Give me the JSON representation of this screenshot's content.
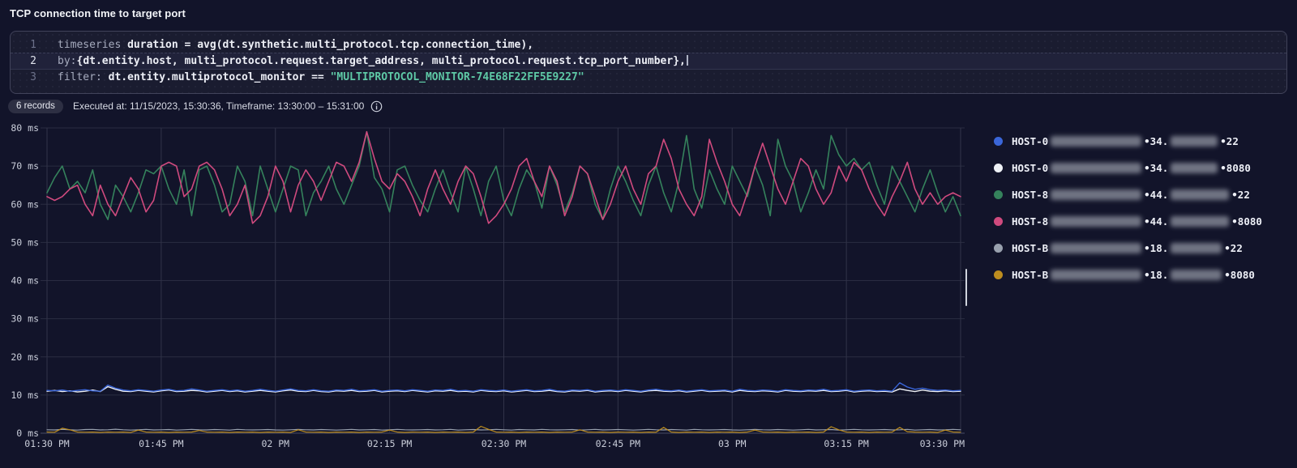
{
  "header": {
    "title": "TCP connection time to target port"
  },
  "editor": {
    "lines": [
      {
        "number": "1",
        "active": false,
        "caret": false,
        "tokens": [
          {
            "c": "kw",
            "t": "timeseries "
          },
          {
            "c": "id",
            "t": "duration"
          },
          {
            "c": "pl",
            "t": " = "
          },
          {
            "c": "id",
            "t": "avg(dt.synthetic.multi_protocol.tcp.connection_time)"
          },
          {
            "c": "pl",
            "t": ","
          }
        ]
      },
      {
        "number": "2",
        "active": true,
        "caret": true,
        "tokens": [
          {
            "c": "kw",
            "t": "by:"
          },
          {
            "c": "pl",
            "t": "{"
          },
          {
            "c": "id",
            "t": "dt.entity.host"
          },
          {
            "c": "pl",
            "t": ", "
          },
          {
            "c": "id",
            "t": "multi_protocol.request.target_address"
          },
          {
            "c": "pl",
            "t": ", "
          },
          {
            "c": "id",
            "t": "multi_protocol.request.tcp_port_number"
          },
          {
            "c": "pl",
            "t": "},"
          }
        ]
      },
      {
        "number": "3",
        "active": false,
        "caret": false,
        "tokens": [
          {
            "c": "kw",
            "t": "filter: "
          },
          {
            "c": "id",
            "t": "dt.entity.multiprotocol_monitor"
          },
          {
            "c": "pl",
            "t": " == "
          },
          {
            "c": "str",
            "t": "\"MULTIPROTOCOL_MONITOR-74E68F22FF5E9227\""
          }
        ]
      }
    ]
  },
  "meta": {
    "records_badge": "6 records",
    "executed_text": "Executed at: 11/15/2023, 15:30:36, Timeframe: 13:30:00 – 15:31:00"
  },
  "legend": {
    "items": [
      {
        "dot_color": "#3a66d9",
        "host": "HOST-0",
        "ip_prefix": "•34.",
        "port": "•22",
        "name_blur_width": 112,
        "ip_blur_width": 58
      },
      {
        "dot_color": "#eef1f6",
        "host": "HOST-0",
        "ip_prefix": "•34.",
        "port": "•8080",
        "name_blur_width": 112,
        "ip_blur_width": 58
      },
      {
        "dot_color": "#35825c",
        "host": "HOST-8",
        "ip_prefix": "•44.",
        "port": "•22",
        "name_blur_width": 112,
        "ip_blur_width": 72
      },
      {
        "dot_color": "#cf4a7e",
        "host": "HOST-8",
        "ip_prefix": "•44.",
        "port": "•8080",
        "name_blur_width": 112,
        "ip_blur_width": 72
      },
      {
        "dot_color": "#99a1ae",
        "host": "HOST-B",
        "ip_prefix": "•18.",
        "port": "•22",
        "name_blur_width": 112,
        "ip_blur_width": 63
      },
      {
        "dot_color": "#bd8d1f",
        "host": "HOST-B",
        "ip_prefix": "•18.",
        "port": "•8080",
        "name_blur_width": 112,
        "ip_blur_width": 63
      }
    ]
  },
  "chart_data": {
    "type": "line",
    "title": "TCP connection time to target port",
    "xlabel": "",
    "ylabel": "ms",
    "ylim": [
      0,
      80
    ],
    "grid": true,
    "legend_position": "right",
    "x_start": "13:30",
    "x_end": "15:30",
    "interval_minutes": 1,
    "y_ticks": [
      "0 ms",
      "10 ms",
      "20 ms",
      "30 ms",
      "40 ms",
      "50 ms",
      "60 ms",
      "70 ms",
      "80 ms"
    ],
    "x_ticks": [
      "01:30 PM",
      "01:45 PM",
      "02 PM",
      "02:15 PM",
      "02:30 PM",
      "02:45 PM",
      "03 PM",
      "03:15 PM",
      "03:30 PM"
    ],
    "series": [
      {
        "name": "HOST-B(redacted) •18.(redacted) •22",
        "color": "#99a1ae",
        "values": [
          0.9,
          0.85,
          1.0,
          0.9,
          0.8,
          0.95,
          1.0,
          0.85,
          0.9,
          1.05,
          0.9,
          0.8,
          0.9,
          1.0,
          0.85,
          0.9,
          0.95,
          0.8,
          0.9,
          1.0,
          0.9,
          0.85,
          0.95,
          0.9,
          0.8,
          1.0,
          0.9,
          0.85,
          0.9,
          0.95,
          0.85,
          0.8,
          0.9,
          1.0,
          0.9,
          0.85,
          0.95,
          0.9,
          0.8,
          0.9,
          1.0,
          0.85,
          0.9,
          0.95,
          0.8,
          0.9,
          1.0,
          0.9,
          0.85,
          0.9,
          0.95,
          0.85,
          0.9,
          1.0,
          0.8,
          0.9,
          0.95,
          0.85,
          0.9,
          1.0,
          0.9,
          0.8,
          0.95,
          0.9,
          0.85,
          1.0,
          0.9,
          0.85,
          0.9,
          0.95,
          0.8,
          0.9,
          1.0,
          0.85,
          0.9,
          0.95,
          0.9,
          0.8,
          0.9,
          1.0,
          0.9,
          0.85,
          0.95,
          0.9,
          0.8,
          1.0,
          0.9,
          0.85,
          0.9,
          0.95,
          0.85,
          0.8,
          0.9,
          1.0,
          0.9,
          0.85,
          0.95,
          0.9,
          0.8,
          0.9,
          1.0,
          0.85,
          0.9,
          0.95,
          0.8,
          0.9,
          1.0,
          0.9,
          0.85,
          0.9,
          0.95,
          0.85,
          0.9,
          1.0,
          0.8,
          0.9,
          0.95,
          0.85,
          0.9,
          1.0,
          0.9
        ]
      },
      {
        "name": "HOST-B(redacted) •18.(redacted) •8080",
        "color": "#bd8d1f",
        "values": [
          0.3,
          0.25,
          1.3,
          0.9,
          0.3,
          0.25,
          0.3,
          0.2,
          0.3,
          0.25,
          0.3,
          0.2,
          0.8,
          0.3,
          0.25,
          0.3,
          0.2,
          0.3,
          0.25,
          0.3,
          0.7,
          0.3,
          0.25,
          0.3,
          0.2,
          0.3,
          0.25,
          0.3,
          0.2,
          0.3,
          0.25,
          0.3,
          0.2,
          0.9,
          0.3,
          0.25,
          0.3,
          0.2,
          0.3,
          0.25,
          0.3,
          0.2,
          0.3,
          0.25,
          0.3,
          0.8,
          0.3,
          0.2,
          0.3,
          0.25,
          0.3,
          0.2,
          0.3,
          0.25,
          0.3,
          0.2,
          0.3,
          1.8,
          1.0,
          0.3,
          0.25,
          0.3,
          0.2,
          0.3,
          0.25,
          0.3,
          0.2,
          0.3,
          0.25,
          0.3,
          0.9,
          0.3,
          0.25,
          0.3,
          0.2,
          0.3,
          0.25,
          0.3,
          0.2,
          0.3,
          0.25,
          1.5,
          0.3,
          0.2,
          0.3,
          0.25,
          0.3,
          0.2,
          0.3,
          0.25,
          0.3,
          0.2,
          0.3,
          0.8,
          0.3,
          0.25,
          0.3,
          0.2,
          0.3,
          0.25,
          0.3,
          0.2,
          0.3,
          1.7,
          0.9,
          0.3,
          0.25,
          0.3,
          0.2,
          0.3,
          0.25,
          0.3,
          1.5,
          0.4,
          0.3,
          0.25,
          0.3,
          0.2,
          0.8,
          0.3,
          0.25
        ]
      },
      {
        "name": "HOST-0(redacted) •34.(redacted) •8080",
        "color": "#eef1f6",
        "values": [
          11.0,
          11.2,
          10.9,
          11.1,
          10.8,
          11.0,
          11.3,
          10.9,
          12.2,
          11.5,
          11.0,
          10.9,
          11.2,
          11.0,
          10.8,
          11.1,
          11.3,
          10.9,
          11.0,
          11.2,
          11.1,
          10.8,
          11.0,
          11.2,
          10.9,
          11.1,
          10.8,
          11.0,
          11.2,
          11.0,
          10.8,
          11.1,
          11.3,
          11.0,
          10.9,
          11.2,
          10.9,
          10.8,
          11.1,
          11.0,
          11.2,
          10.9,
          11.0,
          11.2,
          10.8,
          11.0,
          11.1,
          10.9,
          11.2,
          11.0,
          10.8,
          11.1,
          11.0,
          11.2,
          10.9,
          11.0,
          10.8,
          11.2,
          11.0,
          10.9,
          11.1,
          10.8,
          11.0,
          11.2,
          10.9,
          11.0,
          11.2,
          10.9,
          10.8,
          11.1,
          11.0,
          11.2,
          10.8,
          11.0,
          11.1,
          10.9,
          11.2,
          11.0,
          10.8,
          11.1,
          11.2,
          11.0,
          10.9,
          11.1,
          10.8,
          11.0,
          11.2,
          10.9,
          11.0,
          11.1,
          10.8,
          11.2,
          11.0,
          10.9,
          11.1,
          11.0,
          10.8,
          11.2,
          11.0,
          10.9,
          11.1,
          11.0,
          11.2,
          10.9,
          11.0,
          11.2,
          10.8,
          11.0,
          11.1,
          10.9,
          11.0,
          10.8,
          11.6,
          11.2,
          10.9,
          11.3,
          11.0,
          10.9,
          11.1,
          10.9,
          11.0
        ]
      },
      {
        "name": "HOST-0(redacted) •34.(redacted) •22",
        "color": "#3a66d9",
        "values": [
          11.2,
          11.1,
          11.3,
          11.0,
          11.2,
          11.4,
          11.1,
          11.0,
          12.6,
          11.8,
          11.3,
          11.1,
          11.4,
          11.2,
          11.0,
          11.3,
          11.5,
          11.1,
          11.2,
          11.6,
          11.3,
          11.0,
          11.2,
          11.4,
          11.1,
          11.3,
          11.0,
          11.2,
          11.5,
          11.2,
          11.0,
          11.3,
          11.6,
          11.2,
          11.1,
          11.4,
          11.1,
          11.0,
          11.3,
          11.2,
          11.5,
          11.1,
          11.2,
          11.4,
          11.0,
          11.2,
          11.3,
          11.1,
          11.4,
          11.2,
          11.0,
          11.3,
          11.2,
          11.5,
          11.1,
          11.2,
          11.0,
          11.4,
          11.2,
          11.1,
          11.3,
          11.0,
          11.2,
          11.4,
          11.1,
          11.2,
          11.5,
          11.1,
          11.0,
          11.3,
          11.2,
          11.4,
          11.0,
          11.2,
          11.3,
          11.1,
          11.4,
          11.2,
          11.0,
          11.3,
          11.5,
          11.2,
          11.1,
          11.3,
          11.0,
          11.2,
          11.4,
          11.1,
          11.2,
          11.3,
          11.0,
          11.5,
          11.2,
          11.1,
          11.3,
          11.2,
          11.0,
          11.4,
          11.2,
          11.1,
          11.3,
          11.2,
          11.5,
          11.1,
          11.2,
          11.4,
          11.0,
          11.2,
          11.3,
          11.1,
          11.2,
          11.0,
          13.2,
          12.1,
          11.5,
          11.8,
          11.4,
          11.2,
          11.3,
          11.1,
          11.2
        ]
      },
      {
        "name": "HOST-8(redacted) •44.(redacted) •22",
        "color": "#35825c",
        "values": [
          63,
          67,
          70,
          64,
          66,
          63,
          69,
          60,
          56,
          65,
          62,
          58,
          63,
          69,
          68,
          70,
          64,
          60,
          69,
          57,
          69,
          70,
          65,
          58,
          60,
          70,
          66,
          57,
          70,
          64,
          58,
          64,
          70,
          69,
          57,
          63,
          66,
          70,
          64,
          60,
          65,
          70,
          79,
          67,
          64,
          58,
          69,
          70,
          65,
          61,
          58,
          64,
          69,
          63,
          58,
          70,
          64,
          57,
          66,
          70,
          61,
          57,
          64,
          69,
          66,
          59,
          70,
          65,
          58,
          63,
          70,
          68,
          60,
          56,
          64,
          70,
          66,
          61,
          57,
          65,
          70,
          63,
          58,
          66,
          78,
          64,
          59,
          69,
          64,
          60,
          70,
          66,
          62,
          70,
          65,
          57,
          77,
          70,
          66,
          58,
          63,
          69,
          64,
          78,
          73,
          70,
          72,
          69,
          71,
          65,
          60,
          70,
          66,
          62,
          58,
          64,
          69,
          63,
          58,
          62,
          57
        ]
      },
      {
        "name": "HOST-8(redacted) •44.(redacted) •8080",
        "color": "#cf4a7e",
        "values": [
          62,
          61,
          62,
          64,
          65,
          60,
          57,
          65,
          60,
          57,
          62,
          67,
          64,
          58,
          61,
          70,
          71,
          70,
          62,
          64,
          70,
          71,
          69,
          64,
          57,
          60,
          65,
          55,
          57,
          62,
          70,
          66,
          58,
          65,
          69,
          66,
          61,
          66,
          71,
          70,
          66,
          71,
          79,
          72,
          66,
          64,
          68,
          66,
          62,
          57,
          64,
          69,
          64,
          60,
          66,
          70,
          68,
          62,
          55,
          57,
          60,
          64,
          70,
          72,
          66,
          62,
          70,
          66,
          57,
          62,
          70,
          68,
          62,
          56,
          60,
          66,
          70,
          64,
          60,
          68,
          70,
          77,
          72,
          64,
          60,
          57,
          62,
          77,
          71,
          66,
          60,
          57,
          63,
          70,
          76,
          70,
          64,
          60,
          66,
          72,
          70,
          64,
          60,
          63,
          70,
          66,
          71,
          69,
          64,
          60,
          57,
          62,
          66,
          71,
          64,
          60,
          63,
          60,
          62,
          63,
          62
        ]
      }
    ]
  },
  "colors": {
    "background": "#12142a",
    "editor_bg": "#1a1c30",
    "editor_border": "#41435a",
    "grid_h": "#2a2c41",
    "grid_v": "#313349",
    "axis_line": "#3e415a",
    "string_token": "#5ec9a6"
  }
}
